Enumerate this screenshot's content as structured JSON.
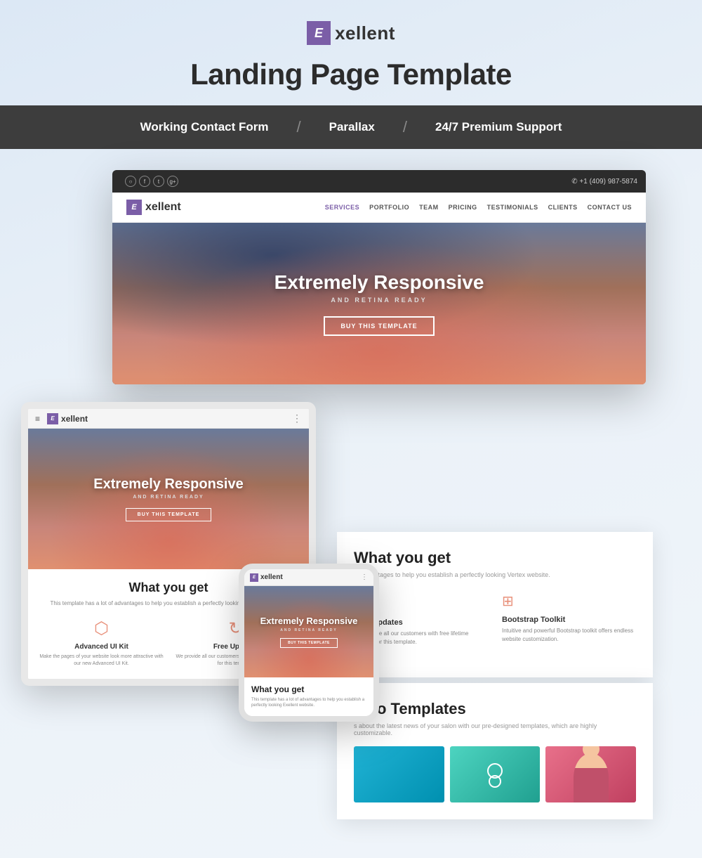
{
  "header": {
    "logo_text": "xellent",
    "logo_letter": "E",
    "main_title": "Landing Page Template"
  },
  "features_bar": {
    "items": [
      {
        "label": "Working Contact Form"
      },
      {
        "divider": "/"
      },
      {
        "label": "Parallax"
      },
      {
        "divider": "/"
      },
      {
        "label": "24/7 Premium Support"
      }
    ]
  },
  "desktop_site": {
    "logo_letter": "E",
    "logo_text": "xellent",
    "nav_links": [
      "SERVICES",
      "PORTFOLIO",
      "TEAM",
      "PRICING",
      "TESTIMONIALS",
      "CLIENTS",
      "CONTACT US"
    ],
    "phone": "✆ +1 (409) 987-5874",
    "hero_title": "Extremely Responsive",
    "hero_subtitle": "AND RETINA READY",
    "hero_btn": "BUY THIS TEMPLATE"
  },
  "tablet_site": {
    "logo_letter": "E",
    "logo_text": "xellent",
    "hero_title": "Extremely Responsive",
    "hero_subtitle": "AND RETINA READY",
    "hero_btn": "BUY THIS TEMPLATE",
    "section_title": "What you get",
    "section_sub": "This template has a lot of advantages to help you establish a perfectly looking Exellent website.",
    "features": [
      {
        "icon": "⬡",
        "title": "Advanced UI Kit",
        "desc": "Make the pages of your website look more attractive with our new Advanced UI Kit."
      },
      {
        "icon": "↻",
        "title": "Free Updates",
        "desc": "We provide all our customers with free lifetime updates for this template."
      }
    ]
  },
  "phone_site": {
    "logo_letter": "E",
    "logo_text": "xellent",
    "hero_title": "Extremely Responsive",
    "hero_subtitle": "AND RETINA READY",
    "hero_btn": "BUY THIS TEMPLATE",
    "section_title": "What you get",
    "section_sub": "This template has a lot of advantages to help you establish a perfectly looking Exellent website."
  },
  "right_panel": {
    "section_title": "What you get",
    "section_sub": "of advantages to help you establish a perfectly looking Vertex website.",
    "features": [
      {
        "icon": "↻",
        "title": "Free Updates",
        "desc": "We provide all our customers with free lifetime updates for this template."
      },
      {
        "icon": "⊞",
        "title": "Bootstrap Toolkit",
        "desc": "Intuitive and powerful Bootstrap toolkit offers endless website customization."
      }
    ]
  },
  "portfolio_panel": {
    "title": "folio Templates",
    "sub": "s about the latest news of your salon with our pre-designed\ntemplates, which are highly customizable.",
    "images": [
      "teal-bg",
      "green-bg",
      "person-bg"
    ]
  },
  "colors": {
    "brand_purple": "#7b5ea7",
    "dark_bar": "#3d3d3d",
    "icon_orange": "#e8907a",
    "text_dark": "#2c2c2c",
    "text_mid": "#555",
    "text_light": "#888"
  }
}
